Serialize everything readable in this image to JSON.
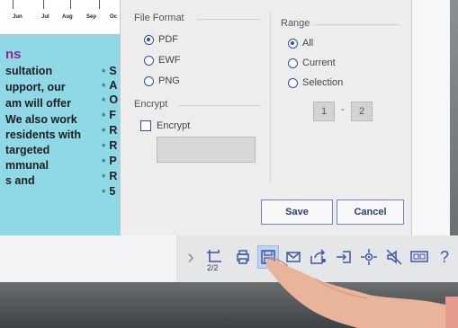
{
  "document": {
    "months": [
      "Jun",
      "Jul",
      "Aug",
      "Sep",
      "Oc"
    ],
    "heading": "ns",
    "left_lines": [
      "sultation",
      "upport, our",
      "am will offer",
      " We also work",
      "residents with",
      " targeted",
      "mmunal",
      "s and"
    ],
    "bullet_letters": [
      "S",
      "A",
      "O",
      "F",
      "R",
      "R",
      "P",
      "R",
      "5"
    ]
  },
  "dialog": {
    "file_format": {
      "title": "File Format",
      "options": [
        {
          "label": "PDF",
          "selected": true
        },
        {
          "label": "EWF",
          "selected": false
        },
        {
          "label": "PNG",
          "selected": false
        }
      ]
    },
    "encrypt": {
      "title": "Encrypt",
      "checkbox_label": "Encrypt",
      "checked": false
    },
    "range": {
      "title": "Range",
      "options": [
        {
          "label": "All",
          "selected": true
        },
        {
          "label": "Current",
          "selected": false
        },
        {
          "label": "Selection",
          "selected": false
        }
      ],
      "from": "1",
      "separator": "-",
      "to": "2"
    },
    "save_label": "Save",
    "cancel_label": "Cancel"
  },
  "toolbar": {
    "page_count": "2/2",
    "question_glyph": "?",
    "icons": [
      "chevron-right-icon",
      "add-page-icon",
      "print-icon",
      "save-icon",
      "email-icon",
      "share-icon",
      "import-icon",
      "pointer-icon",
      "no-sound-icon",
      "dual-screen-icon",
      "help-icon"
    ],
    "active_icon": "save-icon"
  },
  "colors": {
    "accent": "#2c4fb0",
    "doc_background": "#8fd8e6",
    "heading": "#8a2a8f",
    "active_toolbar": "#bfd5ef"
  }
}
